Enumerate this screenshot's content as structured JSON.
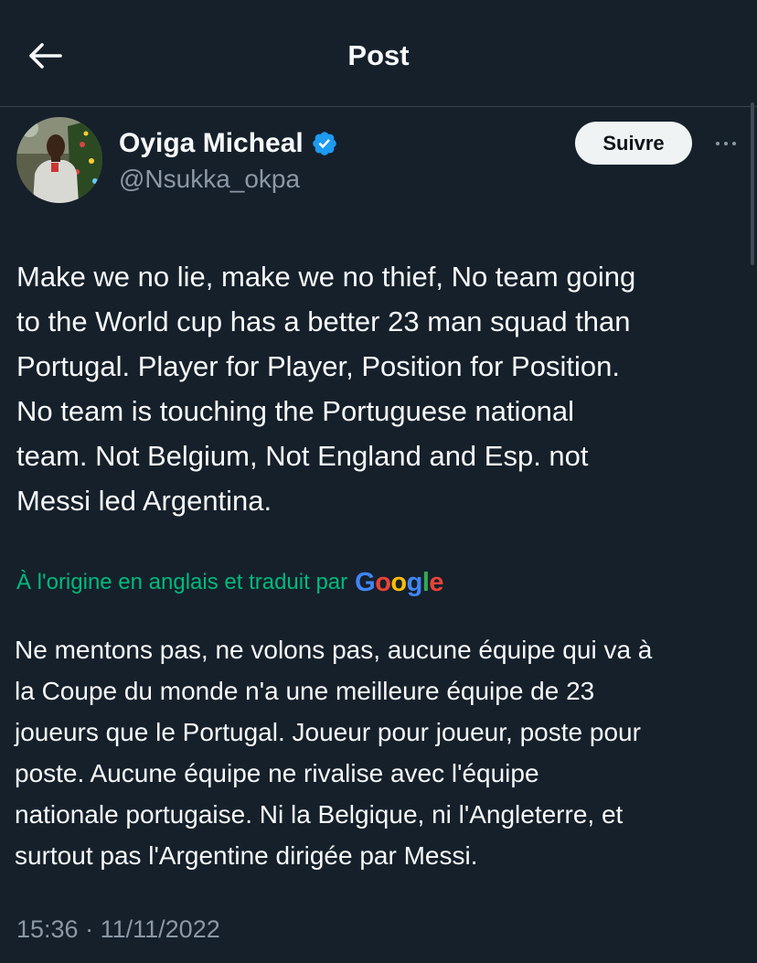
{
  "header": {
    "title": "Post",
    "back_icon": "arrow-left-icon"
  },
  "author": {
    "display_name": "Oyiga Micheal",
    "handle": "@Nsukka_okpa",
    "verified_icon": "verified-badge-icon",
    "verified_color": "#1d9bf0"
  },
  "actions": {
    "follow_label": "Suivre",
    "more_icon": "more-horizontal-icon"
  },
  "post": {
    "text_lines": [
      "Make we no lie, make we no thief, No team going",
      "to the World cup has a better 23 man squad than",
      "Portugal. Player for Player, Position for Position.",
      "No team is touching the Portuguese national",
      "team. Not Belgium, Not England and Esp. not",
      "Messi led Argentina."
    ],
    "translation_notice": "À l'origine en anglais et traduit par",
    "translation_provider": "Google",
    "translated_lines": [
      "Ne mentons pas, ne volons pas, aucune équipe qui va à",
      "la Coupe du monde n'a une meilleure équipe de 23",
      "joueurs que le Portugal. Joueur pour joueur, poste pour",
      "poste. Aucune équipe ne rivalise avec l'équipe",
      "nationale portugaise. Ni la Belgique, ni l'Angleterre, et",
      "surtout pas l'Argentine dirigée par Messi."
    ],
    "time": "15:36",
    "separator": "·",
    "date": "11/11/2022"
  },
  "colors": {
    "background": "#15202b",
    "text_primary": "#f7f9f9",
    "text_secondary": "#8b98a5",
    "translation_green": "#00ba7c",
    "google_blue": "#4285f4",
    "google_red": "#ea4335",
    "google_yellow": "#fbbc05",
    "google_green": "#34a853"
  }
}
